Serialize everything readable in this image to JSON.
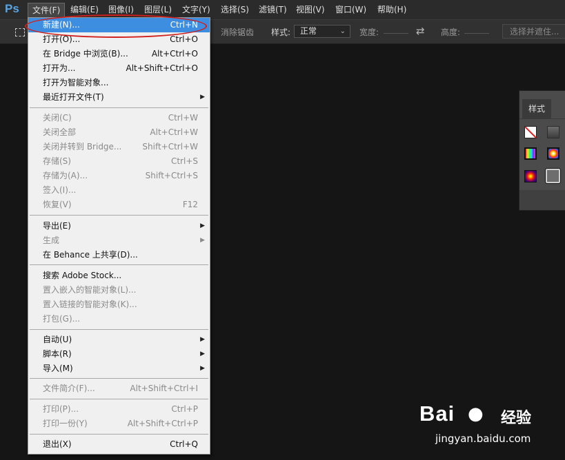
{
  "app": {
    "logo": "Ps"
  },
  "menubar": {
    "items": [
      {
        "label": "文件(F)",
        "active": true
      },
      {
        "label": "编辑(E)"
      },
      {
        "label": "图像(I)"
      },
      {
        "label": "图层(L)"
      },
      {
        "label": "文字(Y)"
      },
      {
        "label": "选择(S)"
      },
      {
        "label": "滤镜(T)"
      },
      {
        "label": "视图(V)"
      },
      {
        "label": "窗口(W)"
      },
      {
        "label": "帮助(H)"
      }
    ]
  },
  "options_bar": {
    "antialias": "消除锯齿",
    "style_label": "样式:",
    "style_value": "正常",
    "width_label": "宽度:",
    "height_label": "高度:",
    "select_mask_button": "选择并遮住..."
  },
  "styles_panel": {
    "tab": "样式",
    "swatches": [
      "none-style",
      "gray-style",
      "rainbow-style",
      "gradient-style",
      "glow-style",
      "outline-style"
    ]
  },
  "file_menu": {
    "items": [
      {
        "label": "新建(N)...",
        "shortcut": "Ctrl+N",
        "highlighted": true
      },
      {
        "label": "打开(O)...",
        "shortcut": "Ctrl+O"
      },
      {
        "label": "在 Bridge 中浏览(B)...",
        "shortcut": "Alt+Ctrl+O"
      },
      {
        "label": "打开为...",
        "shortcut": "Alt+Shift+Ctrl+O"
      },
      {
        "label": "打开为智能对象..."
      },
      {
        "label": "最近打开文件(T)",
        "submenu": true
      },
      {
        "separator": true
      },
      {
        "label": "关闭(C)",
        "shortcut": "Ctrl+W",
        "disabled": true
      },
      {
        "label": "关闭全部",
        "shortcut": "Alt+Ctrl+W",
        "disabled": true
      },
      {
        "label": "关闭并转到 Bridge...",
        "shortcut": "Shift+Ctrl+W",
        "disabled": true
      },
      {
        "label": "存储(S)",
        "shortcut": "Ctrl+S",
        "disabled": true
      },
      {
        "label": "存储为(A)...",
        "shortcut": "Shift+Ctrl+S",
        "disabled": true
      },
      {
        "label": "签入(I)...",
        "disabled": true
      },
      {
        "label": "恢复(V)",
        "shortcut": "F12",
        "disabled": true
      },
      {
        "separator": true
      },
      {
        "label": "导出(E)",
        "submenu": true
      },
      {
        "label": "生成",
        "submenu": true,
        "disabled": true
      },
      {
        "label": "在 Behance 上共享(D)..."
      },
      {
        "separator": true
      },
      {
        "label": "搜索 Adobe Stock..."
      },
      {
        "label": "置入嵌入的智能对象(L)...",
        "disabled": true
      },
      {
        "label": "置入链接的智能对象(K)...",
        "disabled": true
      },
      {
        "label": "打包(G)...",
        "disabled": true
      },
      {
        "separator": true
      },
      {
        "label": "自动(U)",
        "submenu": true
      },
      {
        "label": "脚本(R)",
        "submenu": true
      },
      {
        "label": "导入(M)",
        "submenu": true
      },
      {
        "separator": true
      },
      {
        "label": "文件简介(F)...",
        "shortcut": "Alt+Shift+Ctrl+I",
        "disabled": true
      },
      {
        "separator": true
      },
      {
        "label": "打印(P)...",
        "shortcut": "Ctrl+P",
        "disabled": true
      },
      {
        "label": "打印一份(Y)",
        "shortcut": "Alt+Shift+Ctrl+P",
        "disabled": true
      },
      {
        "separator": true
      },
      {
        "label": "退出(X)",
        "shortcut": "Ctrl+Q"
      }
    ]
  },
  "watermark": {
    "brand": "Bai",
    "brand2": "经验",
    "url": "jingyan.baidu.com"
  }
}
